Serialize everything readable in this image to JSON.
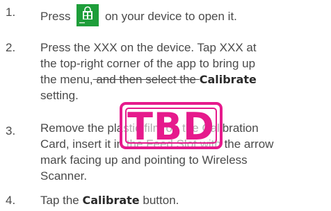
{
  "steps": [
    {
      "num": "1.",
      "text_before": "Press",
      "text_after": "on your device to open it.",
      "icon": "store-app-icon"
    },
    {
      "num": "2.",
      "line1": "Press the XXX on the device. Tap XXX at",
      "line2": "the top-right corner of the app to bring up",
      "line3_a": "the menu,",
      "line3_strike": " and then select the ",
      "line3_bold": "Calibrate",
      "line4": "setting."
    },
    {
      "num": "3.",
      "line1_a": "Remove the plastic film on the Calibration",
      "line2_a": "Card, insert it in the Feed Slot with the arrow",
      "line3": "mark facing up and pointing to Wireless",
      "line4": "Scanner."
    },
    {
      "num": "4.",
      "text_before": "Tap the ",
      "bold": "Calibrate",
      "text_after": " button."
    }
  ],
  "stamp": {
    "text": "TBD",
    "color": "#e61a8c"
  },
  "colors": {
    "text": "#4a4a4a",
    "icon_bg": "#1e9e3a"
  }
}
